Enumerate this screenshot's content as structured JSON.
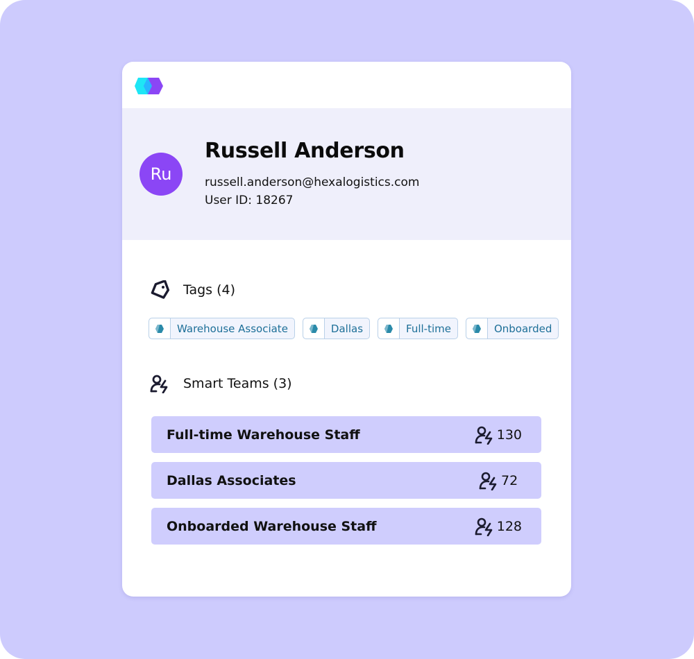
{
  "brand": {
    "logo_icon": "hexagon-logo-icon",
    "colors": {
      "cyan": "#1ee6f5",
      "purple": "#8b46f5",
      "overlap": "#27b6ff"
    }
  },
  "profile": {
    "avatar_initials": "Ru",
    "avatar_color": "#8b46f5",
    "name": "Russell Anderson",
    "email": "russell.anderson@hexalogistics.com",
    "user_id": "User ID: 18267"
  },
  "tags_section": {
    "icon": "tag-icon",
    "title": "Tags (4)",
    "tags": [
      {
        "label": "Warehouse Associate",
        "icon": "hexagon-icon"
      },
      {
        "label": "Dallas",
        "icon": "hexagon-icon"
      },
      {
        "label": "Full-time",
        "icon": "hexagon-icon"
      },
      {
        "label": "Onboarded",
        "icon": "hexagon-icon"
      }
    ]
  },
  "teams_section": {
    "icon": "smart-team-icon",
    "title": "Smart Teams (3)",
    "teams": [
      {
        "name": "Full-time Warehouse Staff",
        "count": "130",
        "icon": "smart-team-icon"
      },
      {
        "name": "Dallas Associates",
        "count": "72",
        "icon": "smart-team-icon"
      },
      {
        "name": "Onboarded Warehouse Staff",
        "count": "128",
        "icon": "smart-team-icon"
      }
    ]
  }
}
